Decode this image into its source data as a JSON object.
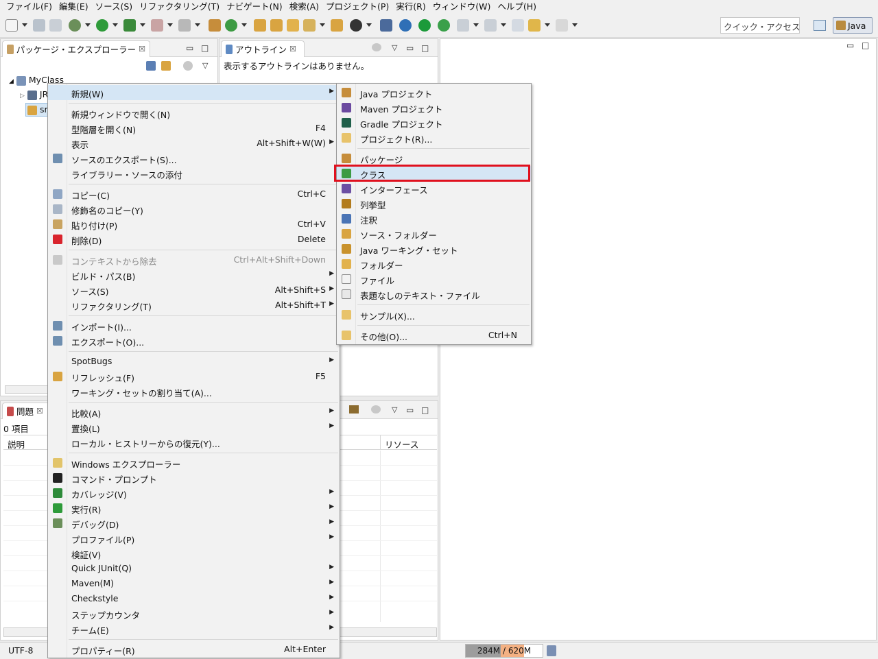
{
  "menubar": [
    "ファイル(F)",
    "編集(E)",
    "ソース(S)",
    "リファクタリング(T)",
    "ナビゲート(N)",
    "検索(A)",
    "プロジェクト(P)",
    "実行(R)",
    "ウィンドウ(W)",
    "ヘルプ(H)"
  ],
  "toolbar": {
    "quick_access": "クイック・アクセス",
    "perspective": "Java"
  },
  "package_explorer": {
    "tab_label": "パッケージ・エクスプローラー",
    "close": "☒",
    "tree": {
      "project": "MyClass",
      "child1": "JR",
      "child2": "sr"
    }
  },
  "outline": {
    "tab_label": "アウトライン",
    "close": "☒",
    "message": "表示するアウトラインはありません。"
  },
  "problems": {
    "tab_label": "問題",
    "close": "☒",
    "count": "0 項目",
    "col_description": "説明",
    "col_resource": "リソース"
  },
  "status": {
    "encoding": "UTF-8",
    "heap": "284M / 620M",
    "heap_used_fraction": 0.458
  },
  "context_menu": {
    "items": [
      {
        "label": "新規(W)",
        "submenu": true
      },
      {
        "label": "新規ウィンドウで開く(N)"
      },
      {
        "label": "型階層を開く(N)",
        "key": "F4"
      },
      {
        "label": "表示",
        "key": "Alt+Shift+W(W)",
        "submenu": true
      },
      {
        "label": "ソースのエクスポート(S)..."
      },
      {
        "label": "ライブラリー・ソースの添付"
      },
      {
        "label": "コピー(C)",
        "key": "Ctrl+C"
      },
      {
        "label": "修飾名のコピー(Y)"
      },
      {
        "label": "貼り付け(P)",
        "key": "Ctrl+V"
      },
      {
        "label": "削除(D)",
        "key": "Delete"
      },
      {
        "label": "コンテキストから除去",
        "key": "Ctrl+Alt+Shift+Down"
      },
      {
        "label": "ビルド・パス(B)",
        "submenu": true
      },
      {
        "label": "ソース(S)",
        "key": "Alt+Shift+S",
        "submenu": true
      },
      {
        "label": "リファクタリング(T)",
        "key": "Alt+Shift+T",
        "submenu": true
      },
      {
        "label": "インポート(I)..."
      },
      {
        "label": "エクスポート(O)..."
      },
      {
        "label": "SpotBugs",
        "submenu": true
      },
      {
        "label": "リフレッシュ(F)",
        "key": "F5"
      },
      {
        "label": "ワーキング・セットの割り当て(A)..."
      },
      {
        "label": "比較(A)",
        "submenu": true
      },
      {
        "label": "置換(L)",
        "submenu": true
      },
      {
        "label": "ローカル・ヒストリーからの復元(Y)..."
      },
      {
        "label": "Windows エクスプローラー"
      },
      {
        "label": "コマンド・プロンプト"
      },
      {
        "label": "カバレッジ(V)",
        "submenu": true
      },
      {
        "label": "実行(R)",
        "submenu": true
      },
      {
        "label": "デバッグ(D)",
        "submenu": true
      },
      {
        "label": "プロファイル(P)",
        "submenu": true
      },
      {
        "label": "検証(V)"
      },
      {
        "label": "Quick JUnit(Q)",
        "submenu": true
      },
      {
        "label": "Maven(M)",
        "submenu": true
      },
      {
        "label": "Checkstyle",
        "submenu": true
      },
      {
        "label": "ステップカウンタ",
        "submenu": true
      },
      {
        "label": "チーム(E)",
        "submenu": true
      },
      {
        "label": "プロパティー(R)",
        "key": "Alt+Enter"
      }
    ]
  },
  "submenu_new": {
    "items": [
      {
        "label": "Java プロジェクト"
      },
      {
        "label": "Maven プロジェクト"
      },
      {
        "label": "Gradle プロジェクト"
      },
      {
        "label": "プロジェクト(R)..."
      },
      {
        "label": "パッケージ"
      },
      {
        "label": "クラス"
      },
      {
        "label": "インターフェース"
      },
      {
        "label": "列挙型"
      },
      {
        "label": "注釈"
      },
      {
        "label": "ソース・フォルダー"
      },
      {
        "label": "Java ワーキング・セット"
      },
      {
        "label": "フォルダー"
      },
      {
        "label": "ファイル"
      },
      {
        "label": "表題なしのテキスト・ファイル"
      },
      {
        "label": "サンプル(X)..."
      },
      {
        "label": "その他(O)...",
        "key": "Ctrl+N"
      }
    ]
  },
  "colors": {
    "highlight_box": "#e0101e",
    "hover": "#d5e6f5"
  }
}
